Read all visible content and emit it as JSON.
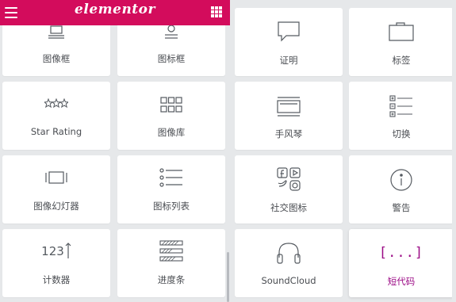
{
  "header": {
    "brand": "elementor",
    "brand_color": "#d30c5c"
  },
  "left_widgets": [
    {
      "label": "图像框",
      "icon": "image-box-icon"
    },
    {
      "label": "图标框",
      "icon": "icon-box-icon"
    },
    {
      "label": "Star Rating",
      "icon": "star-rating-icon"
    },
    {
      "label": "图像库",
      "icon": "image-gallery-icon"
    },
    {
      "label": "图像幻灯器",
      "icon": "image-carousel-icon"
    },
    {
      "label": "图标列表",
      "icon": "icon-list-icon"
    },
    {
      "label": "计数器",
      "icon": "counter-icon",
      "glyph": "123"
    },
    {
      "label": "进度条",
      "icon": "progress-bar-icon"
    }
  ],
  "right_widgets": [
    {
      "label": "证明",
      "icon": "testimonial-icon"
    },
    {
      "label": "标签",
      "icon": "tabs-icon"
    },
    {
      "label": "手风琴",
      "icon": "accordion-icon"
    },
    {
      "label": "切换",
      "icon": "toggle-icon"
    },
    {
      "label": "社交图标",
      "icon": "social-icons-icon"
    },
    {
      "label": "警告",
      "icon": "alert-icon"
    },
    {
      "label": "SoundCloud",
      "icon": "soundcloud-icon"
    },
    {
      "label": "短代码",
      "icon": "shortcode-icon",
      "glyph": "[...]",
      "active": true
    }
  ],
  "colors": {
    "accent": "#d30c5c",
    "active_label": "#9b0a85",
    "background": "#e6e8ea",
    "icon": "#555a60"
  }
}
